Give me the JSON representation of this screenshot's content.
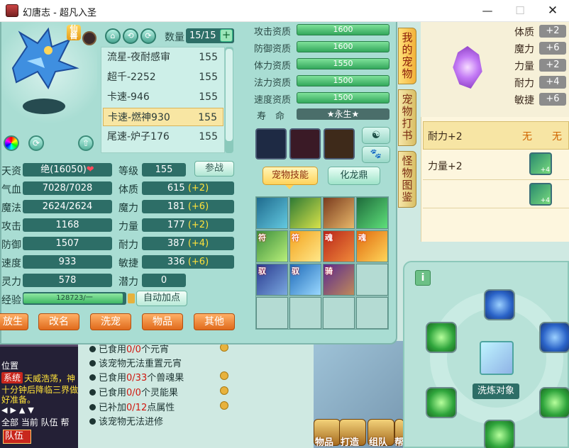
{
  "window": {
    "title": "幻唐志 - 超凡入圣",
    "min": "—",
    "max": "☐",
    "close": "✕"
  },
  "pet": {
    "badge": "仙兽",
    "count_label": "数量",
    "count": "15/15",
    "plus": "+",
    "list": [
      {
        "name": "流星-夜耐感审",
        "level": "155"
      },
      {
        "name": "超千-2252",
        "level": "155"
      },
      {
        "name": "卡速-946",
        "level": "155"
      },
      {
        "name": "卡速-燃神930",
        "level": "155"
      },
      {
        "name": "尾速-炉子176",
        "level": "155"
      }
    ],
    "stats_left": [
      {
        "label": "天资",
        "value": "绝(16050)",
        "heart": "❤"
      },
      {
        "label": "气血",
        "value": "7028/7028"
      },
      {
        "label": "魔法",
        "value": "2624/2624"
      },
      {
        "label": "攻击",
        "value": "1168"
      },
      {
        "label": "防御",
        "value": "1507"
      },
      {
        "label": "速度",
        "value": "933"
      },
      {
        "label": "灵力",
        "value": "578"
      },
      {
        "label": "经验",
        "value": ""
      }
    ],
    "stats_right": [
      {
        "label": "等级",
        "value": "155",
        "bonus": ""
      },
      {
        "label": "体质",
        "value": "615",
        "bonus": "(+2)"
      },
      {
        "label": "魔力",
        "value": "181",
        "bonus": "(+6)"
      },
      {
        "label": "力量",
        "value": "177",
        "bonus": "(+2)"
      },
      {
        "label": "耐力",
        "value": "387",
        "bonus": "(+4)"
      },
      {
        "label": "敏捷",
        "value": "336",
        "bonus": "(+6)"
      },
      {
        "label": "潜力",
        "value": "0",
        "bonus": ""
      }
    ],
    "fight_btn": "参战",
    "exp_text": "128723/一",
    "auto_btn": "自动加点",
    "bottom_btns": [
      "放生",
      "改名",
      "洗宠",
      "物品",
      "其他"
    ]
  },
  "aptitude": [
    {
      "label": "攻击资质",
      "value": "1600"
    },
    {
      "label": "防御资质",
      "value": "1600"
    },
    {
      "label": "体力资质",
      "value": "1550"
    },
    {
      "label": "法力资质",
      "value": "1500"
    },
    {
      "label": "速度资质",
      "value": "1500"
    }
  ],
  "life": {
    "label": "寿　命",
    "value": "★永生★"
  },
  "equip_btns": [
    "☯",
    "🐾"
  ],
  "skill_tabs": {
    "skill": "宠物技能",
    "dragon": "化龙鼎"
  },
  "skills": [
    {
      "badge": ""
    },
    {
      "badge": ""
    },
    {
      "badge": ""
    },
    {
      "badge": ""
    },
    {
      "badge": "符"
    },
    {
      "badge": "符"
    },
    {
      "badge": "魂"
    },
    {
      "badge": "魂"
    },
    {
      "badge": "驭"
    },
    {
      "badge": "驭"
    },
    {
      "badge": "骑"
    },
    {
      "badge": ""
    },
    {
      "badge": ""
    },
    {
      "badge": ""
    },
    {
      "badge": ""
    },
    {
      "badge": ""
    }
  ],
  "side_tabs": [
    "我的宠物",
    "宠物打书",
    "怪物图鉴"
  ],
  "attr_panel": {
    "attrs": [
      {
        "label": "体质",
        "value": "+2"
      },
      {
        "label": "魔力",
        "value": "+6"
      },
      {
        "label": "力量",
        "value": "+2"
      },
      {
        "label": "耐力",
        "value": "+4"
      },
      {
        "label": "敏捷",
        "value": "+6"
      }
    ],
    "hl_left": "耐力+2",
    "hl_right": "无　　无",
    "row2": "力量+2",
    "sk_badges": [
      "+4",
      "+4"
    ]
  },
  "wash": {
    "info": "i",
    "target_label": "洗炼对象"
  },
  "info_lines": [
    {
      "pre": "已食用",
      "red": "0/0",
      "post": "个元宵"
    },
    {
      "pre": "该宠物无法重置元宵",
      "red": "",
      "post": ""
    },
    {
      "pre": "已食用",
      "red": "0/33",
      "post": "个兽魂果"
    },
    {
      "pre": "已食用",
      "red": "0/0",
      "post": "个灵能果"
    },
    {
      "pre": "已补加",
      "red": "0/12",
      "post": "点属性"
    },
    {
      "pre": "该宠物无法进修",
      "red": "",
      "post": ""
    }
  ],
  "chat": {
    "position": "位置",
    "system": "系统",
    "msg1": "天威浩荡，神",
    "msg2": "十分钟后降临三界做好准备。",
    "arrows": "◀▶▲▼",
    "tabs": "全部 当前 队伍 帮",
    "team": "队伍"
  },
  "bottom_bar": [
    "物品",
    "打造",
    "组队",
    "帮"
  ]
}
